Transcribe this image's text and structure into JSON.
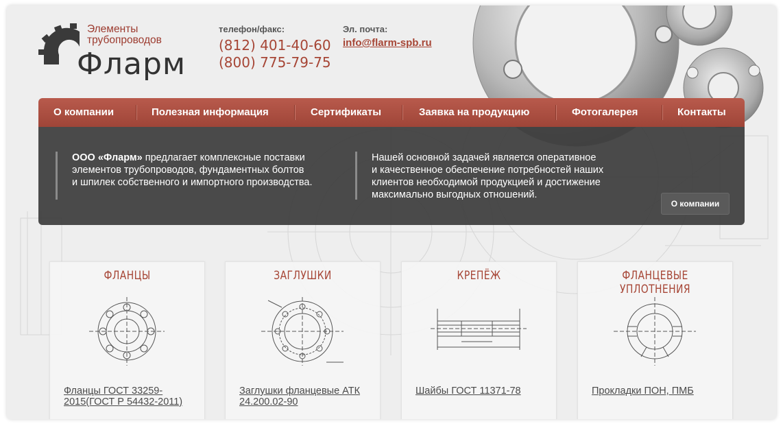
{
  "header": {
    "logo": {
      "line1": "Элементы",
      "line2": "трубопроводов",
      "name": "Фларм"
    },
    "phone_label": "телефон/факс:",
    "phones": [
      "(812) 401-40-60",
      "(800) 775-79-75"
    ],
    "email_label": "Эл. почта:",
    "email": "info@flarm-spb.ru"
  },
  "nav": {
    "items": [
      {
        "label": "О компании"
      },
      {
        "label": "Полезная информация"
      },
      {
        "label": "Сертификаты"
      },
      {
        "label": "Заявка на продукцию"
      },
      {
        "label": "Фотогалерея"
      },
      {
        "label": "Контакты"
      }
    ]
  },
  "intro": {
    "left_bold": "ООО «Фларм»",
    "left_line1_rest": " предлагает комплексные поставки",
    "left_line2": "элементов трубопроводов, фундаментных болтов",
    "left_line3": "и шпилек собственного и импортного производства.",
    "right_line1": "Нашей основной задачей является оперативное",
    "right_line2": "и качественное обеспечение потребностей наших",
    "right_line3": "клиентов необходимой продукцией и достижение",
    "right_line4": "максимально выгодных отношений.",
    "button": "О компании"
  },
  "cards": [
    {
      "title": "ФЛАНЦЫ",
      "link_line1": "Фланцы ГОСТ 33259-",
      "link_line2": "2015(ГОСТ Р 54432-2011)",
      "icon": "flange-drawing-icon"
    },
    {
      "title": "ЗАГЛУШКИ",
      "link_line1": "Заглушки фланцевые АТК",
      "link_line2": "24.200.02-90",
      "icon": "blind-flange-drawing-icon"
    },
    {
      "title": "КРЕПЁЖ",
      "link_line1": "Шайбы ГОСТ 11371-78",
      "link_line2": "",
      "icon": "stud-drawing-icon"
    },
    {
      "title": "ФЛАНЦЕВЫЕ УПЛОТНЕНИЯ",
      "link_line1": "Прокладки ПОН, ПМБ",
      "link_line2": "",
      "icon": "gasket-drawing-icon"
    }
  ],
  "colors": {
    "accent": "#a64535",
    "nav": "#ad5043",
    "band": "#3c3c3c"
  }
}
